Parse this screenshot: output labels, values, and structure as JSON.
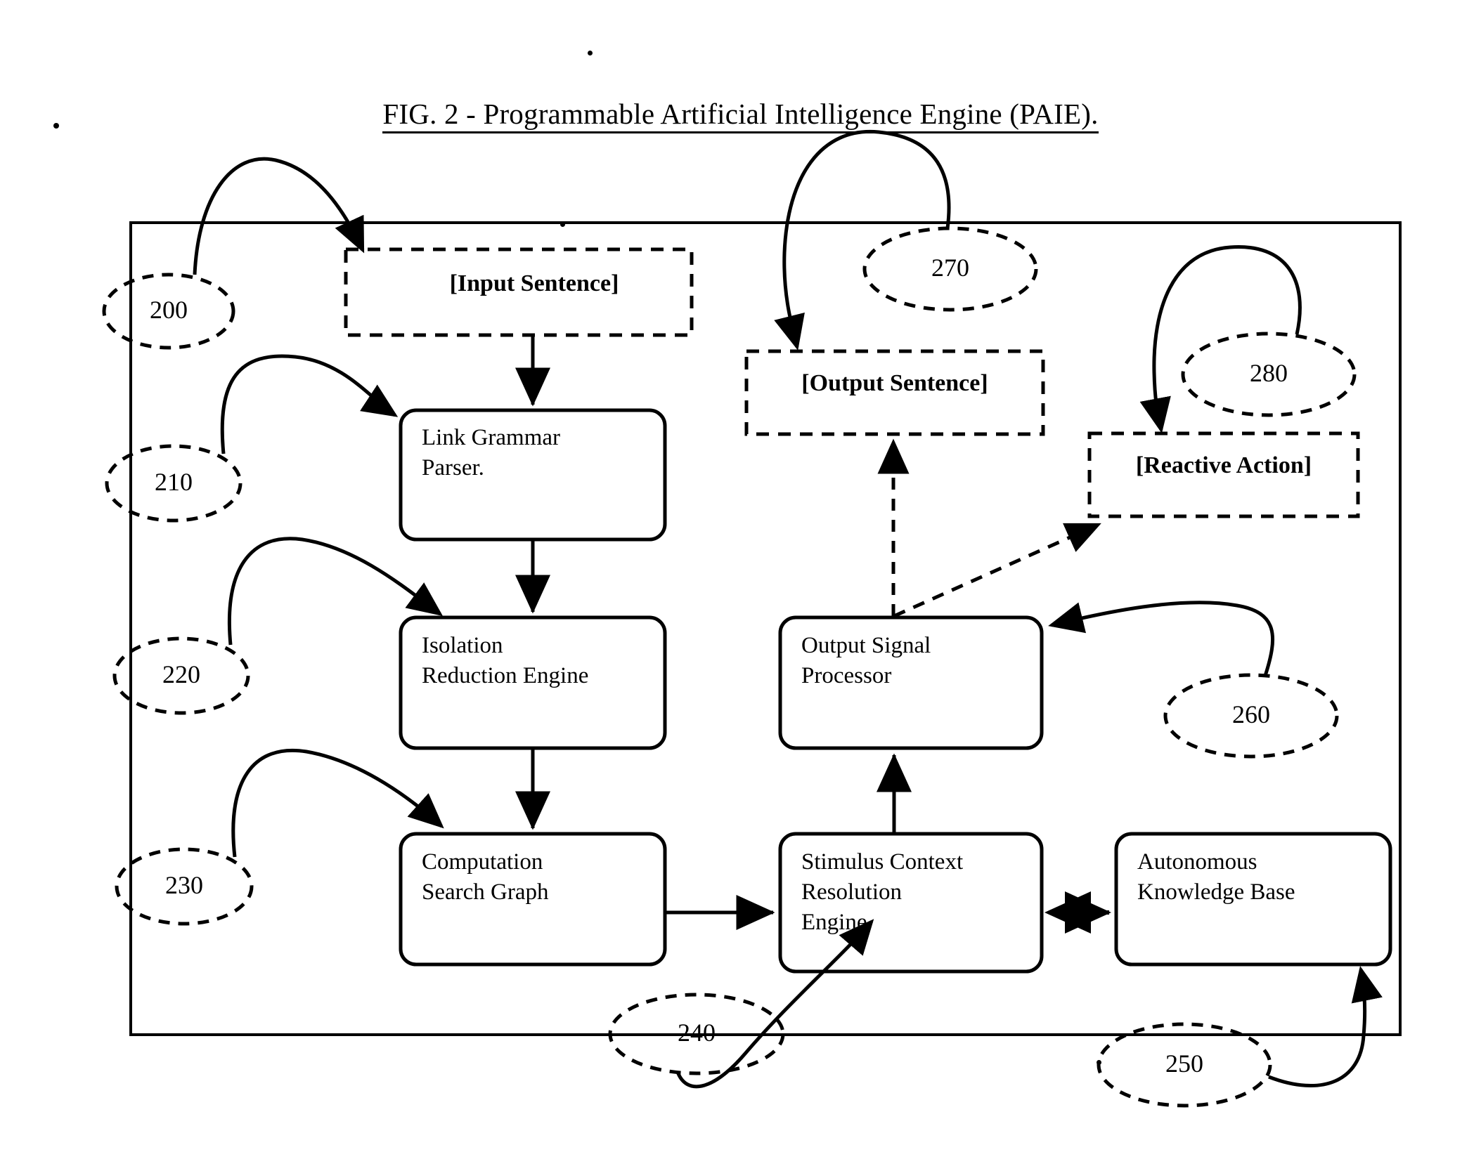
{
  "figure": {
    "title": "FIG. 2 - Programmable Artificial Intelligence Engine (PAIE).",
    "line_color": "#000000",
    "background_color": "#ffffff"
  },
  "nodes": [
    {
      "id": "input_sentence",
      "label": "[Input Sentence]",
      "style": "dashed",
      "bold": true
    },
    {
      "id": "link_grammar",
      "label": "Link Grammar\nParser.",
      "style": "solid",
      "bold": false
    },
    {
      "id": "isolation",
      "label": "Isolation\nReduction Engine",
      "style": "solid",
      "bold": false
    },
    {
      "id": "computation",
      "label": "Computation\nSearch Graph",
      "style": "solid",
      "bold": false
    },
    {
      "id": "output_sentence",
      "label": "[Output Sentence]",
      "style": "dashed",
      "bold": true
    },
    {
      "id": "reactive_action",
      "label": "[Reactive Action]",
      "style": "dashed",
      "bold": true
    },
    {
      "id": "output_signal",
      "label": "Output Signal\nProcessor",
      "style": "solid",
      "bold": false
    },
    {
      "id": "stimulus",
      "label": "Stimulus Context\nResolution\nEngine",
      "style": "solid",
      "bold": false
    },
    {
      "id": "knowledge_base",
      "label": "Autonomous\nKnowledge Base",
      "style": "solid",
      "bold": false
    }
  ],
  "reference_callouts": [
    {
      "id": "ref200",
      "number": "200",
      "points_to": "input_sentence"
    },
    {
      "id": "ref210",
      "number": "210",
      "points_to": "link_grammar"
    },
    {
      "id": "ref220",
      "number": "220",
      "points_to": "isolation"
    },
    {
      "id": "ref230",
      "number": "230",
      "points_to": "computation"
    },
    {
      "id": "ref240",
      "number": "240",
      "points_to": "stimulus"
    },
    {
      "id": "ref250",
      "number": "250",
      "points_to": "knowledge_base"
    },
    {
      "id": "ref260",
      "number": "260",
      "points_to": "output_signal"
    },
    {
      "id": "ref270",
      "number": "270",
      "points_to": "output_sentence"
    },
    {
      "id": "ref280",
      "number": "280",
      "points_to": "reactive_action"
    }
  ],
  "connections": [
    {
      "from": "input_sentence",
      "to": "link_grammar",
      "style": "solid",
      "arrow": "single"
    },
    {
      "from": "link_grammar",
      "to": "isolation",
      "style": "solid",
      "arrow": "single"
    },
    {
      "from": "isolation",
      "to": "computation",
      "style": "solid",
      "arrow": "single"
    },
    {
      "from": "computation",
      "to": "stimulus",
      "style": "solid",
      "arrow": "single"
    },
    {
      "from": "stimulus",
      "to": "output_signal",
      "style": "solid",
      "arrow": "single"
    },
    {
      "from": "stimulus",
      "to": "knowledge_base",
      "style": "solid",
      "arrow": "double"
    },
    {
      "from": "output_signal",
      "to": "output_sentence",
      "style": "dashed",
      "arrow": "single"
    },
    {
      "from": "output_signal",
      "to": "reactive_action",
      "style": "dashed",
      "arrow": "single"
    }
  ]
}
